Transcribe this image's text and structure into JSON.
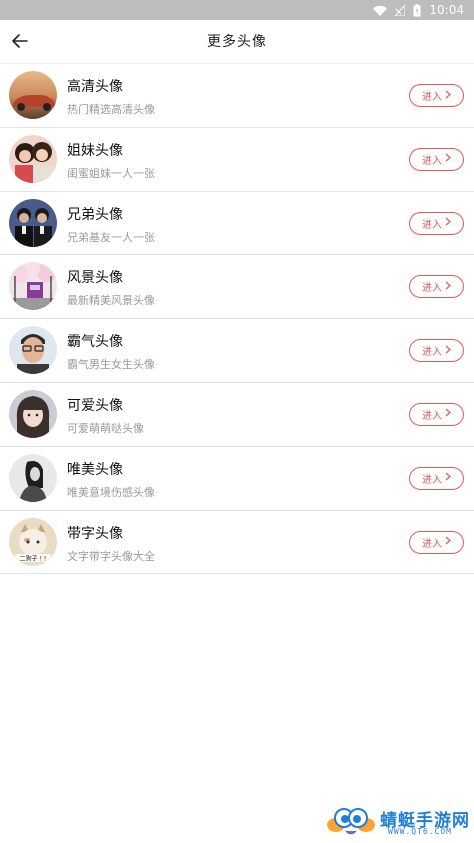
{
  "status_bar": {
    "time": "10:04"
  },
  "header": {
    "title": "更多头像"
  },
  "list": [
    {
      "title": "高清头像",
      "subtitle": "热门精选高清头像",
      "button": "进入",
      "avatar": "car-photo"
    },
    {
      "title": "姐妹头像",
      "subtitle": "闺蜜姐妹一人一张",
      "button": "进入",
      "avatar": "two-girls-photo"
    },
    {
      "title": "兄弟头像",
      "subtitle": "兄弟基友一人一张",
      "button": "进入",
      "avatar": "two-men-photo"
    },
    {
      "title": "风景头像",
      "subtitle": "最新精美风景头像",
      "button": "进入",
      "avatar": "scenery-photo"
    },
    {
      "title": "霸气头像",
      "subtitle": "霸气男生女生头像",
      "button": "进入",
      "avatar": "man-glasses-photo"
    },
    {
      "title": "可爱头像",
      "subtitle": "可爱萌萌哒头像",
      "button": "进入",
      "avatar": "cute-girl-photo"
    },
    {
      "title": "唯美头像",
      "subtitle": "唯美意境伤感头像",
      "button": "进入",
      "avatar": "bw-girl-photo"
    },
    {
      "title": "带字头像",
      "subtitle": "文字带字头像大全",
      "button": "进入",
      "avatar": "cat-text-photo",
      "avatar_text": "二狗子 ! !"
    }
  ],
  "watermark": {
    "name": "蜻蜓手游网",
    "url": "WWW.QT6.COM"
  },
  "colors": {
    "accent": "#e05a5a",
    "status_bar": "#bdbdbd",
    "watermark": "#1f7fd8"
  }
}
